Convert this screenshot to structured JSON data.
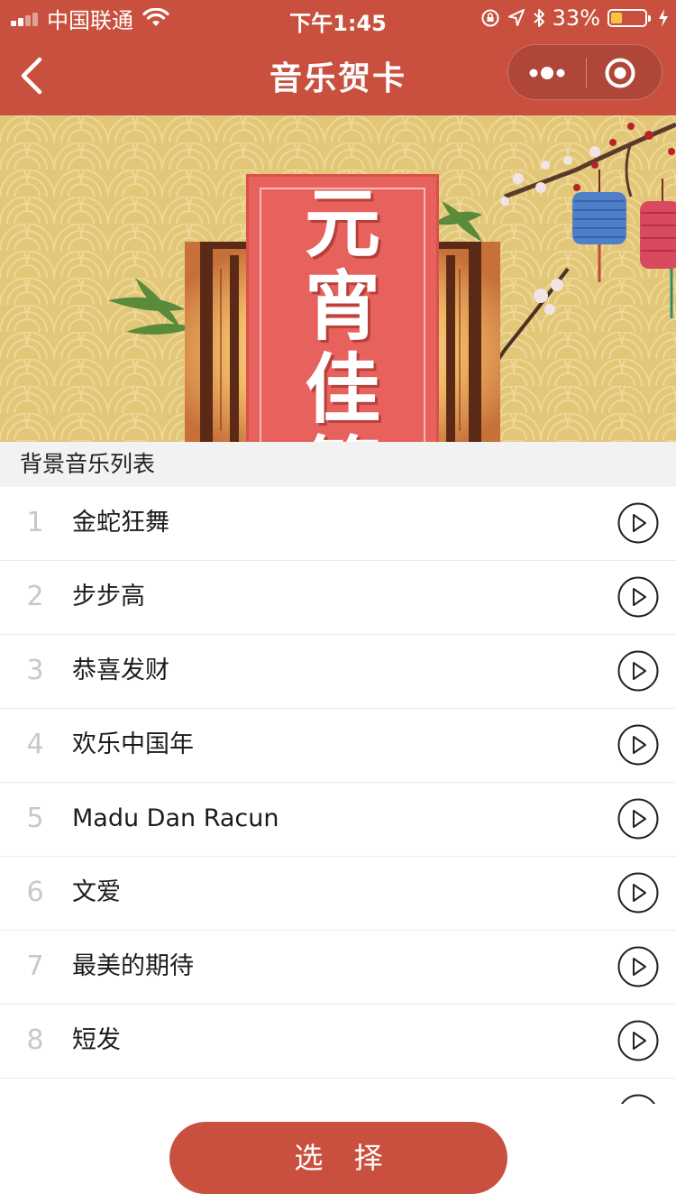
{
  "status_bar": {
    "carrier": "中国联通",
    "time": "下午1:45",
    "battery_percent": "33%",
    "battery_level": 0.33,
    "icons": [
      "signal-icon",
      "wifi-icon",
      "rotation-lock-icon",
      "location-icon",
      "bluetooth-icon",
      "battery-icon",
      "charging-icon"
    ]
  },
  "nav": {
    "title": "音乐贺卡",
    "back_icon": "chevron-left-icon",
    "more_icon": "more-dots-icon",
    "close_icon": "target-close-icon"
  },
  "banner": {
    "title": "元宵佳節"
  },
  "section": {
    "header": "背景音乐列表"
  },
  "songs": [
    {
      "num": "1",
      "title": "金蛇狂舞"
    },
    {
      "num": "2",
      "title": "步步高"
    },
    {
      "num": "3",
      "title": "恭喜发财"
    },
    {
      "num": "4",
      "title": "欢乐中国年"
    },
    {
      "num": "5",
      "title": "Madu Dan Racun"
    },
    {
      "num": "6",
      "title": "文爱"
    },
    {
      "num": "7",
      "title": "最美的期待"
    },
    {
      "num": "8",
      "title": "短发"
    },
    {
      "num": "",
      "title": ""
    }
  ],
  "footer": {
    "select_label": "选 择"
  },
  "colors": {
    "brand": "#c9503f",
    "battery": "#f6c445",
    "banner_bg": "#e6c779",
    "title_strip": "#e8625d"
  }
}
